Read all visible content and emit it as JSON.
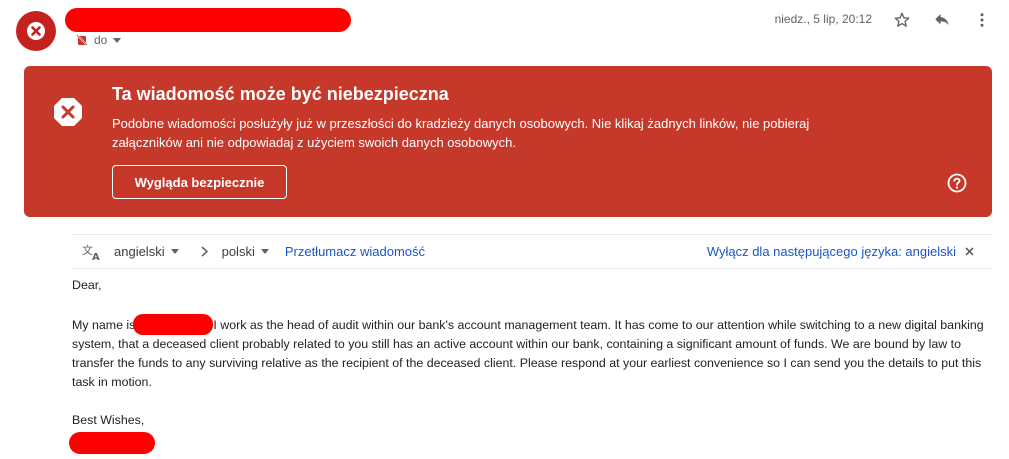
{
  "header": {
    "recipient_label": "do",
    "date": "niedz., 5 lip, 20:12"
  },
  "warning": {
    "title": "Ta wiadomość może być niebezpieczna",
    "body": "Podobne wiadomości posłużyły już w przeszłości do kradzieży danych osobowych. Nie klikaj żadnych linków, nie pobieraj załączników ani nie odpowiadaj z użyciem swoich danych osobowych.",
    "button_label": "Wygląda bezpiecznie"
  },
  "translate": {
    "source_lang": "angielski",
    "target_lang": "polski",
    "translate_link": "Przetłumacz wiadomość",
    "disable_link": "Wyłącz dla następującego języka: angielski"
  },
  "message": {
    "greeting": "Dear,",
    "para_start": "My name is",
    "para_rest": "I work as the head of audit within our bank's account management team. It has come to our attention while switching to a new digital banking system, that a deceased client probably related to you still has an active account within our bank, containing a significant amount of funds. We are bound by law to transfer the funds to any surviving relative as the recipient of the deceased client. Please respond at your earliest convenience so I can send you the details to put this task in motion.",
    "closing": "Best Wishes,"
  },
  "colors": {
    "banner": "#c5382a",
    "avatar": "#c5221f",
    "link": "#1a57c6",
    "redaction": "#ff0000"
  },
  "icons": [
    "danger-icon",
    "no-recipient-icon",
    "chevron-down-icon",
    "star-icon",
    "reply-icon",
    "more-vert-icon",
    "help-icon",
    "translate-icon",
    "chevron-right-icon",
    "close-icon"
  ]
}
